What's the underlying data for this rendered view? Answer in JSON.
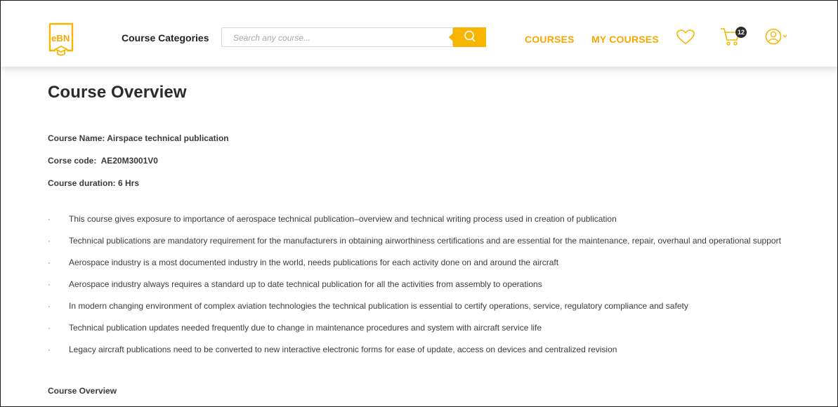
{
  "header": {
    "logo_text": "eBN",
    "categories_label": "Course Categories",
    "search": {
      "placeholder": "Search any course...",
      "value": ""
    },
    "nav": {
      "courses": "COURSES",
      "my_courses": "MY COURSES"
    },
    "cart_count": "12",
    "icons": [
      "search-icon",
      "heart-icon",
      "cart-icon",
      "user-icon",
      "chevron-down-icon"
    ],
    "accent_color": "#f7b500"
  },
  "main": {
    "title": "Course Overview",
    "course_name": "Course Name: Airspace technical publication",
    "course_code": "Corse code:  AE20M3001V0",
    "course_duration": "Course duration: 6 Hrs",
    "bullet_marker": "·",
    "bullets": [
      "This course gives exposure to importance of aerospace technical publication–overview and technical writing process used in creation of publication",
      "Technical publications are mandatory requirement for the manufacturers in obtaining airworthiness certifications and are essential for the maintenance, repair, overhaul and operational support",
      "Aerospace industry is a most documented industry in the world, needs publications for each activity done on and around the aircraft",
      "Aerospace industry always requires a standard up to date technical publication for all the activities from assembly to operations",
      "In modern changing environment of complex aviation technologies the technical publication is essential to certify operations, service, regulatory compliance and safety",
      "Technical publication updates needed frequently due to change in maintenance procedures and system with aircraft service life",
      "Legacy aircraft publications need to be converted to new interactive electronic forms for ease of update, access on devices and centralized revision"
    ],
    "section_heading": "Course Overview"
  }
}
